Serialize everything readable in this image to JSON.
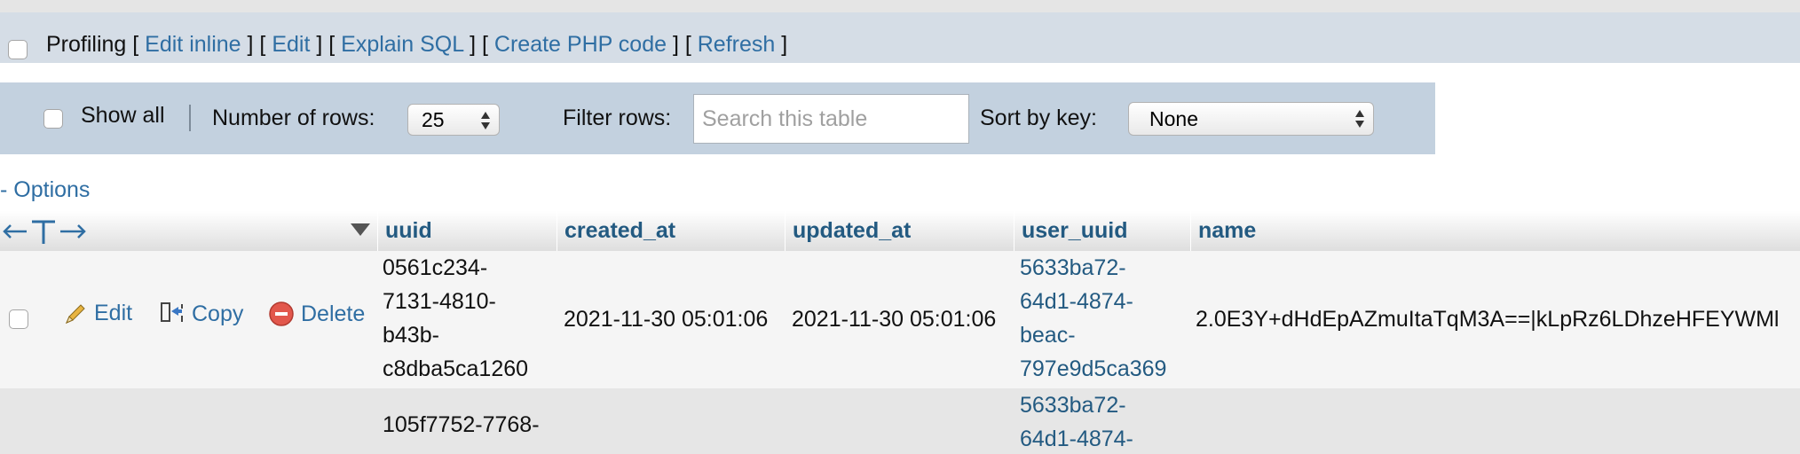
{
  "profiling": {
    "label": "Profiling",
    "links": [
      "Edit inline",
      "Edit",
      "Explain SQL",
      "Create PHP code",
      "Refresh"
    ]
  },
  "nav": {
    "show_all_label": "Show all",
    "rows_label": "Number of rows:",
    "rows_value": "25",
    "filter_label": "Filter rows:",
    "filter_placeholder": "Search this table",
    "sort_label": "Sort by key:",
    "sort_value": "None"
  },
  "options_label": "- Options",
  "table": {
    "columns": [
      "uuid",
      "created_at",
      "updated_at",
      "user_uuid",
      "name"
    ],
    "actions": {
      "edit": "Edit",
      "copy": "Copy",
      "delete": "Delete"
    },
    "rows": [
      {
        "uuid_lines": [
          "0561c234-",
          "7131-4810-",
          "b43b-",
          "c8dba5ca1260"
        ],
        "created_at": "2021-11-30 05:01:06",
        "updated_at": "2021-11-30 05:01:06",
        "user_uuid_lines": [
          "5633ba72-",
          "64d1-4874-",
          "beac-",
          "797e9d5ca369"
        ],
        "name": "2.0E3Y+dHdEpAZmuItaTqM3A==|kLpRz6LDhzeHFEYWMl"
      },
      {
        "uuid_lines": [
          "105f7752-7768-"
        ],
        "created_at": "",
        "updated_at": "",
        "user_uuid_lines": [
          "5633ba72-",
          "64d1-4874-"
        ],
        "name": ""
      }
    ]
  },
  "colors": {
    "link": "#2f6ea3",
    "header_text": "#235a81",
    "nav_bg": "#c3d1df",
    "profiling_bg": "#d5dde6"
  }
}
